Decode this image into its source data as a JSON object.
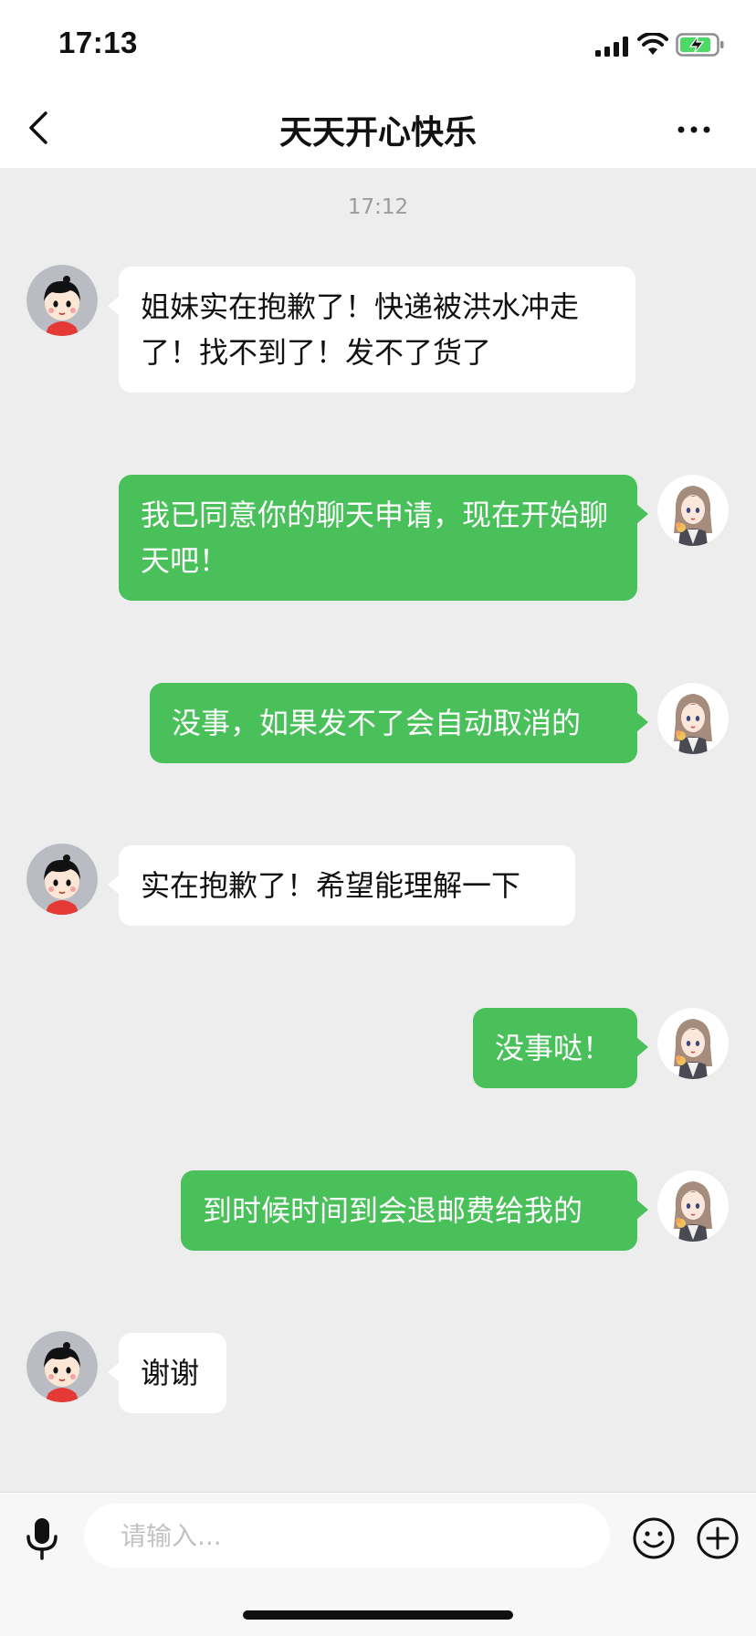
{
  "status_bar": {
    "time": "17:13",
    "icons": [
      "signal-icon",
      "wifi-icon",
      "battery-charging-icon"
    ]
  },
  "nav": {
    "title": "天天开心快乐",
    "back_icon": "chevron-left-icon",
    "more_icon": "ellipsis-icon"
  },
  "chat": {
    "timestamp": "17:12",
    "messages": [
      {
        "from": "contact",
        "text": "姐妹实在抱歉了！快递被洪水冲走了！找不到了！发不了货了"
      },
      {
        "from": "me",
        "text": "我已同意你的聊天申请，现在开始聊天吧！"
      },
      {
        "from": "me",
        "text": "没事，如果发不了会自动取消的"
      },
      {
        "from": "contact",
        "text": "实在抱歉了！希望能理解一下"
      },
      {
        "from": "me",
        "text": "没事哒！"
      },
      {
        "from": "me",
        "text": "到时候时间到会退邮费给我的"
      },
      {
        "from": "contact",
        "text": "谢谢"
      }
    ]
  },
  "input_bar": {
    "placeholder": "请输入...",
    "value": "",
    "icons": [
      "microphone-icon",
      "emoji-icon",
      "plus-circle-icon"
    ]
  },
  "colors": {
    "chat_background": "#EDEDED",
    "outgoing_bubble": "#49C05A",
    "incoming_bubble": "#FFFFFF",
    "battery_charging": "#4CD964"
  }
}
